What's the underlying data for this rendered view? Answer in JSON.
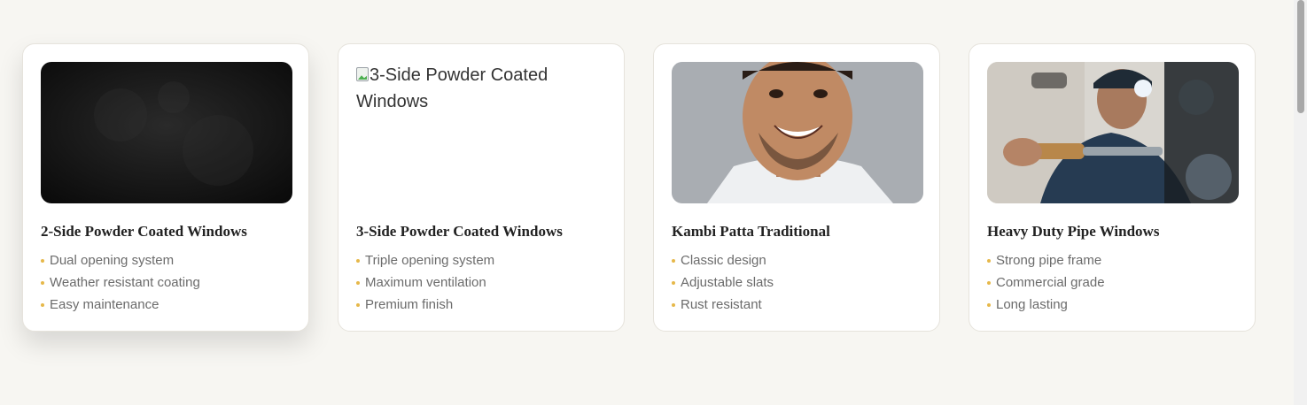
{
  "cards": [
    {
      "title": "2-Side Powder Coated Windows",
      "image_alt": "2-Side Powder Coated Windows",
      "features": [
        "Dual opening system",
        "Weather resistant coating",
        "Easy maintenance"
      ]
    },
    {
      "title": "3-Side Powder Coated Windows",
      "image_alt": "3-Side Powder Coated Windows",
      "features": [
        "Triple opening system",
        "Maximum ventilation",
        "Premium finish"
      ]
    },
    {
      "title": "Kambi Patta Traditional",
      "image_alt": "Kambi Patta Traditional",
      "features": [
        "Classic design",
        "Adjustable slats",
        "Rust resistant"
      ]
    },
    {
      "title": "Heavy Duty Pipe Windows",
      "image_alt": "Heavy Duty Pipe Windows",
      "features": [
        "Strong pipe frame",
        "Commercial grade",
        "Long lasting"
      ]
    }
  ],
  "colors": {
    "background": "#f7f6f2",
    "bullet": "#e6b84a",
    "title": "#222222",
    "feature_text": "#6b6b6b"
  }
}
